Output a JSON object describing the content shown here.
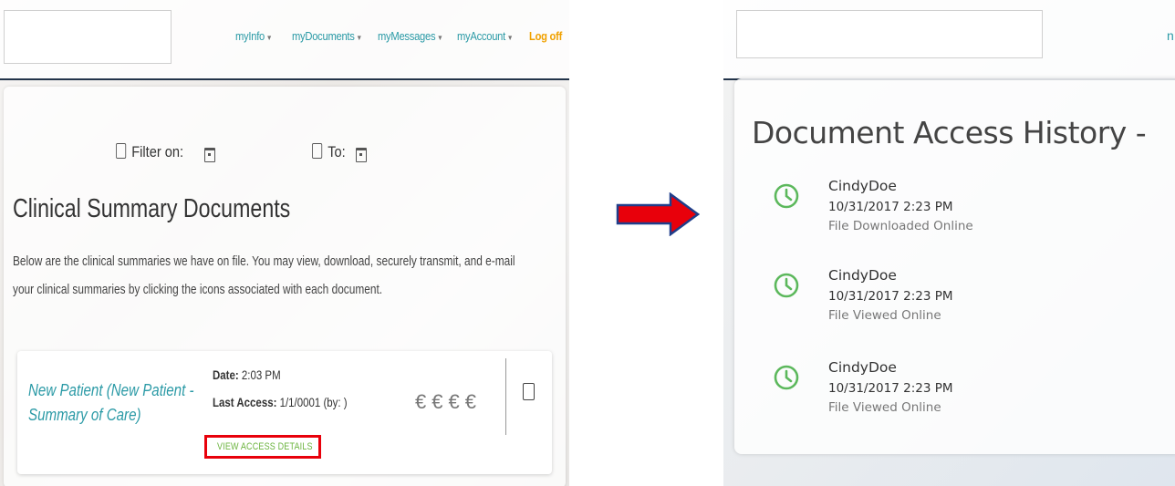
{
  "left": {
    "nav": [
      {
        "label": "myInfo",
        "has_dropdown": true
      },
      {
        "label": "myDocuments",
        "has_dropdown": true
      },
      {
        "label": "myMessages",
        "has_dropdown": true
      },
      {
        "label": "myAccount",
        "has_dropdown": true
      },
      {
        "label": "Log off",
        "has_dropdown": false
      }
    ],
    "filter": {
      "from_label": "Filter on:",
      "to_label": "To:"
    },
    "heading": "Clinical Summary Documents",
    "description": "Below are the clinical summaries we have on file. You may view, download, securely transmit, and e-mail your clinical summaries by clicking the icons associated with each document.",
    "document": {
      "title": "New Patient (New Patient - Summary of Care)",
      "date_label": "Date:",
      "date_value": "2:03 PM",
      "last_access_label": "Last Access:",
      "last_access_value": "1/1/0001 (by: )",
      "view_access_label": "VIEW ACCESS DETAILS"
    }
  },
  "right": {
    "nav_partial": "n",
    "title": "Document Access History -",
    "entries": [
      {
        "user": "CindyDoe",
        "time": "10/31/2017 2:23 PM",
        "action": "File Downloaded Online"
      },
      {
        "user": "CindyDoe",
        "time": "10/31/2017 2:23 PM",
        "action": "File Viewed Online"
      },
      {
        "user": "CindyDoe",
        "time": "10/31/2017 2:23 PM",
        "action": "File Viewed Online"
      }
    ]
  },
  "colors": {
    "link": "#2b9aa6",
    "logoff": "#f0a100",
    "highlight_border": "#e8000b",
    "view_access_text": "#6cb43f",
    "clock_icon": "#5cb85c",
    "arrow_fill": "#e8000b",
    "arrow_outline": "#1f3e8a"
  }
}
